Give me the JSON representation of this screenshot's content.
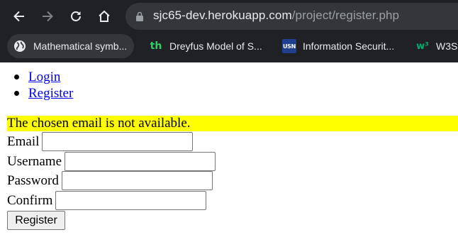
{
  "browser": {
    "url_host": "sjc65-dev.herokuapp.com",
    "url_path": "/project/register.php",
    "bookmarks": [
      {
        "label": "Mathematical symb...",
        "icon": "globe-icon"
      },
      {
        "label": "Dreyfus Model of S...",
        "icon": "th-logo-icon"
      },
      {
        "label": "Information Securit...",
        "icon": "usn-logo-icon"
      },
      {
        "label": "W3S",
        "icon": "w3schools-logo-icon"
      }
    ],
    "colors": {
      "chrome": "#202124",
      "omnibox": "#35363a"
    }
  },
  "nav": {
    "links": [
      {
        "label": "Login"
      },
      {
        "label": "Register"
      }
    ]
  },
  "alert": {
    "message": "The chosen email is not available.",
    "color": "#ffff00"
  },
  "form": {
    "fields": [
      {
        "label": "Email",
        "value": ""
      },
      {
        "label": "Username",
        "value": ""
      },
      {
        "label": "Password",
        "value": ""
      },
      {
        "label": "Confirm",
        "value": ""
      }
    ],
    "submit_label": "Register"
  }
}
